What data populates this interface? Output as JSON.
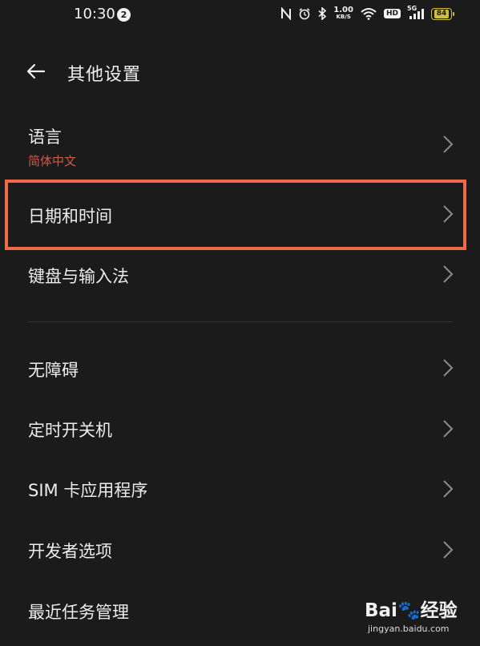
{
  "status_bar": {
    "time": "10:30",
    "notification_count": "2",
    "net_speed_value": "1.00",
    "net_speed_unit": "KB/S",
    "hd_label": "HD",
    "signal_label": "5G",
    "battery_level": "84",
    "icons": [
      "nfc-icon",
      "alarm-icon",
      "bluetooth-icon",
      "wifi-icon",
      "signal-icon",
      "battery-icon"
    ]
  },
  "header": {
    "title": "其他设置",
    "back_icon": "back-arrow-icon"
  },
  "settings": {
    "language": {
      "label": "语言",
      "value": "简体中文"
    },
    "date_time": {
      "label": "日期和时间"
    },
    "keyboard": {
      "label": "键盘与输入法"
    },
    "accessibility": {
      "label": "无障碍"
    },
    "scheduled_power": {
      "label": "定时开关机"
    },
    "sim_toolkit": {
      "label": "SIM 卡应用程序"
    },
    "developer_options": {
      "label": "开发者选项"
    },
    "recent_tasks": {
      "label": "最近任务管理"
    }
  },
  "watermark": {
    "brand": "Bai",
    "brand_suffix": "经验",
    "url": "jingyan.baidu.com"
  },
  "colors": {
    "background": "#1b1b1b",
    "accent_red": "#cf5a4a",
    "highlight": "#f06a4a",
    "battery": "#cdbf3a"
  }
}
